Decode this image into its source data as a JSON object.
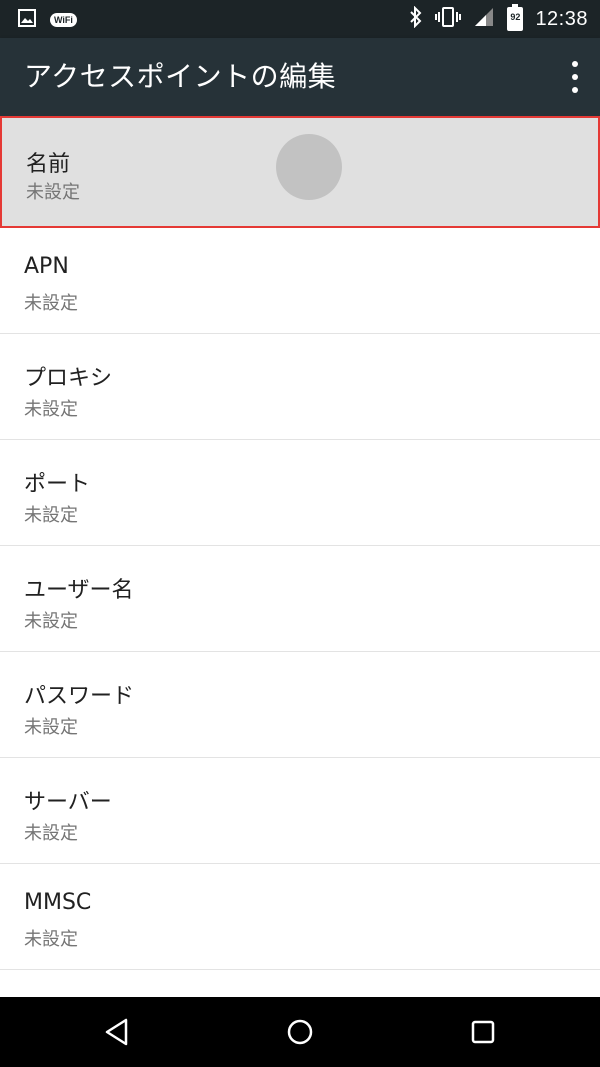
{
  "status_bar": {
    "time": "12:38",
    "wifi_badge": "WiFi",
    "battery_level": "92",
    "icons": [
      "image-icon",
      "wifi-badge-icon",
      "bluetooth-icon",
      "vibrate-icon",
      "signal-icon",
      "battery-icon"
    ]
  },
  "app_bar": {
    "title": "アクセスポイントの編集",
    "overflow_icon": "more-vert-icon"
  },
  "settings": [
    {
      "title": "名前",
      "summary": "未設定",
      "pressed": true
    },
    {
      "title": "APN",
      "summary": "未設定"
    },
    {
      "title": "プロキシ",
      "summary": "未設定"
    },
    {
      "title": "ポート",
      "summary": "未設定"
    },
    {
      "title": "ユーザー名",
      "summary": "未設定"
    },
    {
      "title": "パスワード",
      "summary": "未設定"
    },
    {
      "title": "サーバー",
      "summary": "未設定"
    },
    {
      "title": "MMSC",
      "summary": "未設定"
    }
  ],
  "nav_bar": {
    "icons": [
      "back-icon",
      "home-icon",
      "recents-icon"
    ]
  },
  "colors": {
    "status_bar_bg": "#1c2427",
    "app_bar_bg": "#263238",
    "pressed_row_bg": "#e0e0e0",
    "highlight_border": "#e53935"
  }
}
